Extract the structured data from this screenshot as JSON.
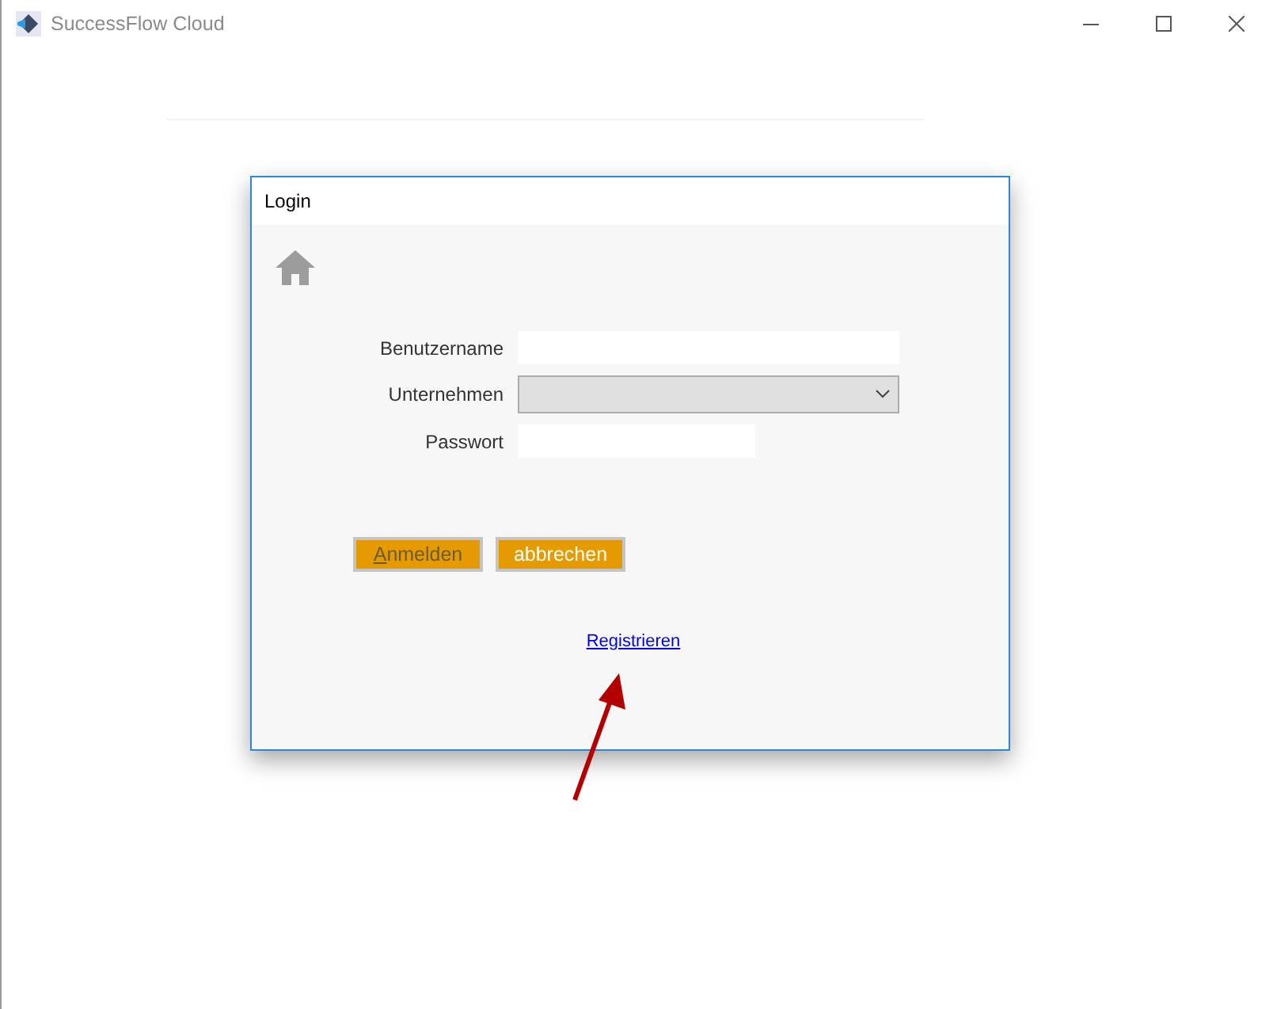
{
  "window": {
    "title": "SuccessFlow Cloud"
  },
  "dialog": {
    "title": "Login",
    "fields": [
      {
        "kind": "text",
        "label": "Benutzername"
      },
      {
        "kind": "select",
        "label": "Unternehmen"
      },
      {
        "kind": "password",
        "label": "Passwort"
      }
    ],
    "buttons": [
      {
        "label": "Anmelden",
        "disabled": true
      },
      {
        "label": "abbrechen",
        "disabled": false
      }
    ],
    "link": "Registrieren"
  }
}
